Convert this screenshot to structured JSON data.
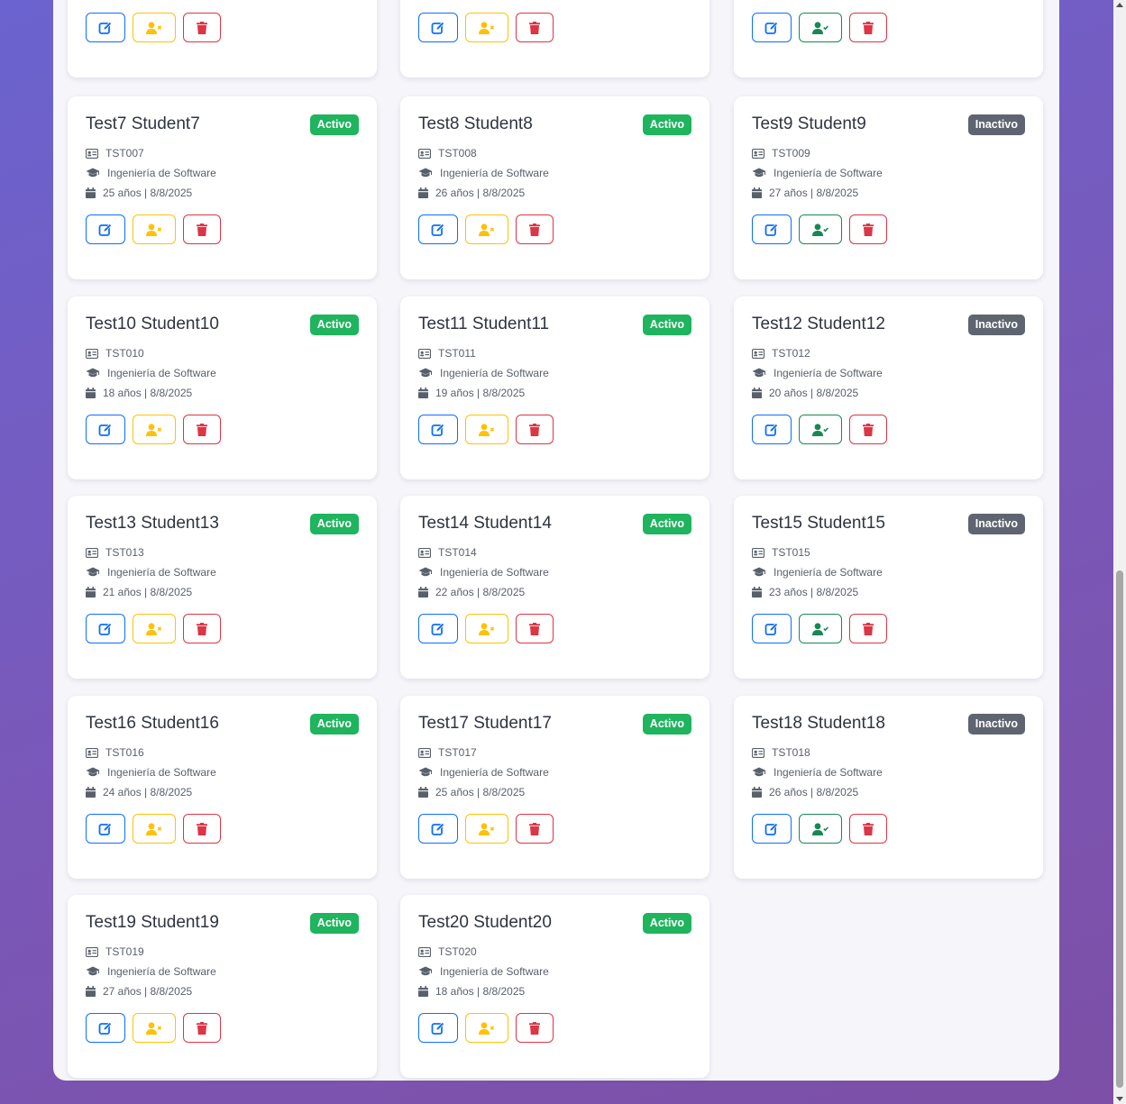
{
  "rows": [
    [
      {
        "name": "",
        "code": "",
        "program": "",
        "meta": "",
        "status": "",
        "active": true
      },
      {
        "name": "",
        "code": "",
        "program": "",
        "meta": "",
        "status": "",
        "active": true
      },
      {
        "name": "",
        "code": "",
        "program": "",
        "meta": "",
        "status": "",
        "active": false
      }
    ],
    [
      {
        "name": "Test7 Student7",
        "code": "TST007",
        "program": "Ingeniería de Software",
        "meta": "25 años | 8/8/2025",
        "status": "Activo",
        "active": true
      },
      {
        "name": "Test8 Student8",
        "code": "TST008",
        "program": "Ingeniería de Software",
        "meta": "26 años | 8/8/2025",
        "status": "Activo",
        "active": true
      },
      {
        "name": "Test9 Student9",
        "code": "TST009",
        "program": "Ingeniería de Software",
        "meta": "27 años | 8/8/2025",
        "status": "Inactivo",
        "active": false
      }
    ],
    [
      {
        "name": "Test10 Student10",
        "code": "TST010",
        "program": "Ingeniería de Software",
        "meta": "18 años | 8/8/2025",
        "status": "Activo",
        "active": true
      },
      {
        "name": "Test11 Student11",
        "code": "TST011",
        "program": "Ingeniería de Software",
        "meta": "19 años | 8/8/2025",
        "status": "Activo",
        "active": true
      },
      {
        "name": "Test12 Student12",
        "code": "TST012",
        "program": "Ingeniería de Software",
        "meta": "20 años | 8/8/2025",
        "status": "Inactivo",
        "active": false
      }
    ],
    [
      {
        "name": "Test13 Student13",
        "code": "TST013",
        "program": "Ingeniería de Software",
        "meta": "21 años | 8/8/2025",
        "status": "Activo",
        "active": true
      },
      {
        "name": "Test14 Student14",
        "code": "TST014",
        "program": "Ingeniería de Software",
        "meta": "22 años | 8/8/2025",
        "status": "Activo",
        "active": true
      },
      {
        "name": "Test15 Student15",
        "code": "TST015",
        "program": "Ingeniería de Software",
        "meta": "23 años | 8/8/2025",
        "status": "Inactivo",
        "active": false
      }
    ],
    [
      {
        "name": "Test16 Student16",
        "code": "TST016",
        "program": "Ingeniería de Software",
        "meta": "24 años | 8/8/2025",
        "status": "Activo",
        "active": true
      },
      {
        "name": "Test17 Student17",
        "code": "TST017",
        "program": "Ingeniería de Software",
        "meta": "25 años | 8/8/2025",
        "status": "Activo",
        "active": true
      },
      {
        "name": "Test18 Student18",
        "code": "TST018",
        "program": "Ingeniería de Software",
        "meta": "26 años | 8/8/2025",
        "status": "Inactivo",
        "active": false
      }
    ],
    [
      {
        "name": "Test19 Student19",
        "code": "TST019",
        "program": "Ingeniería de Software",
        "meta": "27 años | 8/8/2025",
        "status": "Activo",
        "active": true
      },
      {
        "name": "Test20 Student20",
        "code": "TST020",
        "program": "Ingeniería de Software",
        "meta": "18 años | 8/8/2025",
        "status": "Activo",
        "active": true
      }
    ]
  ],
  "icons": {
    "id": "id-card-icon",
    "program": "graduation-cap-icon",
    "date": "calendar-icon",
    "edit": "edit-icon",
    "deactivate": "user-x-icon",
    "activate": "user-check-icon",
    "delete": "trash-icon"
  },
  "colors": {
    "primary": "#0d6efd",
    "warning": "#ffc107",
    "success": "#198754",
    "danger": "#dc3545",
    "badge_active": "#1fb45e",
    "badge_inactive": "#5f6570"
  }
}
